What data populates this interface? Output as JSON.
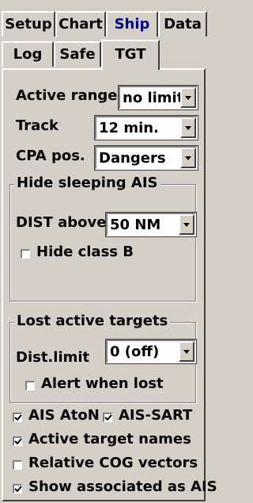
{
  "tabs_row1": [
    "Setup",
    "Chart",
    "Ship",
    "Data"
  ],
  "tabs_row2": [
    "Log",
    "Safe",
    "TGT"
  ],
  "active_tab": "TGT",
  "colors": {
    "ship_tab": "#000080",
    "face": "#d4d0c8"
  },
  "fields": {
    "active_range": {
      "label": "Active range",
      "value": "no limit"
    },
    "track": {
      "label": "Track",
      "value": "12 min."
    },
    "cpa_pos": {
      "label": "CPA pos.",
      "value": "Dangers"
    }
  },
  "hide_sleeping": {
    "title": "Hide sleeping AIS",
    "dist_label": "DIST above",
    "dist_value": "50 NM",
    "hide_class_b": {
      "label": "Hide class B",
      "checked": false
    }
  },
  "lost_targets": {
    "title": "Lost active targets",
    "dist_label": "Dist.limit",
    "dist_value": "0 (off)",
    "alert_when_lost": {
      "label": "Alert when lost",
      "checked": false
    }
  },
  "options": {
    "ais_aton": {
      "label": "AIS AtoN",
      "checked": true
    },
    "ais_sart": {
      "label": "AIS-SART",
      "checked": true
    },
    "active_target_names": {
      "label": "Active target names",
      "checked": true
    },
    "relative_cog": {
      "label": "Relative COG vectors",
      "checked": false
    },
    "show_associated": {
      "label": "Show associated as AIS",
      "checked": true
    }
  }
}
